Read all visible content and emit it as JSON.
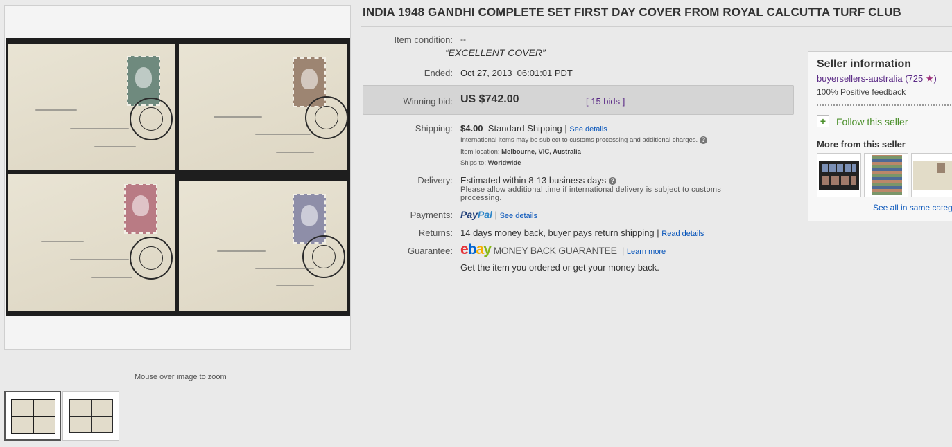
{
  "listing": {
    "title": "INDIA 1948 GANDHI COMPLETE SET FIRST DAY COVER FROM ROYAL CALCUTTA TURF CLUB",
    "zoom_hint": "Mouse over image to zoom"
  },
  "details": {
    "condition_label": "Item condition:",
    "condition_value": "--",
    "condition_quote": "“EXCELLENT COVER”",
    "ended_label": "Ended:",
    "ended_value": "Oct 27, 2013  06:01:01 PDT",
    "winning_label": "Winning bid:",
    "winning_value": "US $742.00",
    "bids": "[ 15 bids ]",
    "shipping_label": "Shipping:",
    "shipping_price": "$4.00",
    "shipping_method": "Standard Shipping |",
    "see_details": "See details",
    "intl_note": "International items may be subject to customs processing and additional charges.",
    "item_location_label": "Item location:",
    "item_location": "Melbourne, VIC, Australia",
    "ships_to_label": "Ships to:",
    "ships_to": "Worldwide",
    "delivery_label": "Delivery:",
    "delivery_value": "Estimated within 8-13 business days",
    "delivery_note_1": "Please allow additional time if international delivery is subject to customs",
    "delivery_note_2": "processing.",
    "payments_label": "Payments:",
    "paypal_1": "Pay",
    "paypal_2": "Pal",
    "payments_sep": "|",
    "payments_link": "See details",
    "returns_label": "Returns:",
    "returns_value": "14 days money back, buyer pays return shipping |",
    "returns_link": "Read details",
    "guarantee_label": "Guarantee:",
    "ebay_e": "e",
    "ebay_b": "b",
    "ebay_a": "a",
    "ebay_y": "y",
    "mbg": "MONEY BACK GUARANTEE",
    "guarantee_sep": "|",
    "learn_more": "Learn more",
    "guarantee_note": "Get the item you ordered or get your money back.",
    "help_glyph": "?"
  },
  "seller": {
    "heading": "Seller information",
    "name": "buyersellers-australia",
    "score": "(725",
    "star": "★",
    "score_close": ")",
    "feedback": "100% Positive feedback",
    "follow": "Follow this seller",
    "follow_icon": "+",
    "more_heading": "More from this seller",
    "see_all": "See all in same categ"
  },
  "colors": {
    "link_blue": "#0654ba",
    "seller_purple": "#5b2a86",
    "follow_green": "#4a8f2a",
    "star_pink": "#a0307a"
  },
  "icons": [
    "help-icon",
    "plus-icon",
    "star-icon",
    "paypal-logo",
    "ebay-logo"
  ]
}
